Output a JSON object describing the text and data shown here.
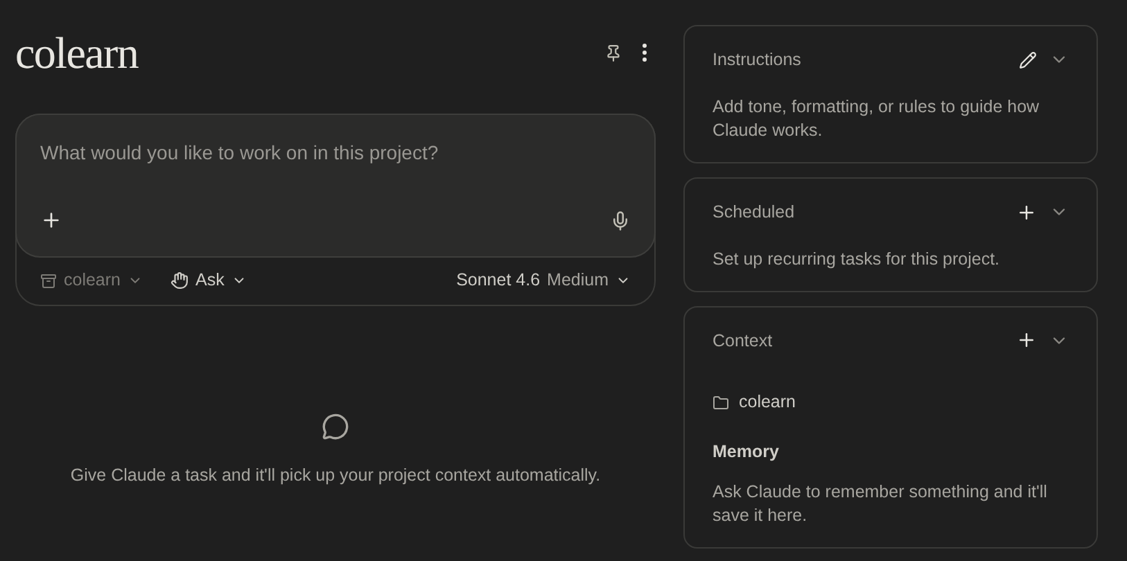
{
  "project": {
    "title": "colearn"
  },
  "composer": {
    "placeholder": "What would you like to work on in this project?",
    "project_chip": "colearn",
    "mode": "Ask",
    "model": "Sonnet 4.6",
    "effort": "Medium"
  },
  "empty_state": {
    "text": "Give Claude a task and it'll pick up your project context automatically."
  },
  "panels": [
    {
      "title": "Instructions",
      "kind": "edit",
      "description": "Add tone, formatting, or rules to guide how Claude works."
    },
    {
      "title": "Scheduled",
      "kind": "add",
      "description": "Set up recurring tasks for this project."
    },
    {
      "title": "Context",
      "kind": "add",
      "folder": "colearn",
      "memory_title": "Memory",
      "memory_text": "Ask Claude to remember something and it'll save it here."
    }
  ]
}
